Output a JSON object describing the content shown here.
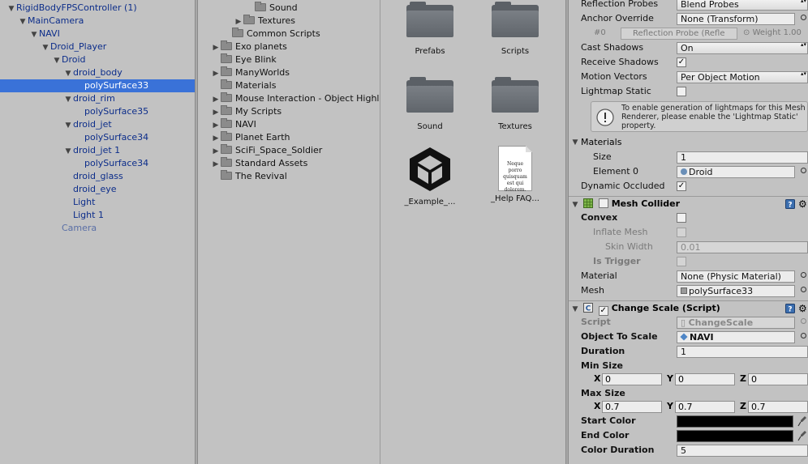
{
  "hierarchy": {
    "items": [
      {
        "label": "RigidBodyFPSController (1)",
        "indent": 0,
        "arrow": "open"
      },
      {
        "label": "MainCamera",
        "indent": 1,
        "arrow": "open"
      },
      {
        "label": "NAVI",
        "indent": 2,
        "arrow": "open"
      },
      {
        "label": "Droid_Player",
        "indent": 3,
        "arrow": "open"
      },
      {
        "label": "Droid",
        "indent": 4,
        "arrow": "open"
      },
      {
        "label": "droid_body",
        "indent": 5,
        "arrow": "open"
      },
      {
        "label": "polySurface33",
        "indent": 6,
        "arrow": "none",
        "selected": true
      },
      {
        "label": "droid_rim",
        "indent": 5,
        "arrow": "open"
      },
      {
        "label": "polySurface35",
        "indent": 6,
        "arrow": "none"
      },
      {
        "label": "droid_jet",
        "indent": 5,
        "arrow": "open"
      },
      {
        "label": "polySurface34",
        "indent": 6,
        "arrow": "none"
      },
      {
        "label": "droid_jet 1",
        "indent": 5,
        "arrow": "open"
      },
      {
        "label": "polySurface34",
        "indent": 6,
        "arrow": "none"
      },
      {
        "label": "droid_glass",
        "indent": 5,
        "arrow": "none"
      },
      {
        "label": "droid_eye",
        "indent": 5,
        "arrow": "none"
      },
      {
        "label": "Light",
        "indent": 5,
        "arrow": "none"
      },
      {
        "label": "Light 1",
        "indent": 5,
        "arrow": "none"
      },
      {
        "label": "Camera",
        "indent": 4,
        "arrow": "none",
        "dim": true
      }
    ]
  },
  "project_tree": {
    "items": [
      {
        "label": "Sound",
        "indent": 3,
        "arrow": "none"
      },
      {
        "label": "Textures",
        "indent": 2,
        "arrow": "closed"
      },
      {
        "label": "Common Scripts",
        "indent": 1,
        "arrow": "none"
      },
      {
        "label": "Exo planets",
        "indent": 0,
        "arrow": "closed"
      },
      {
        "label": "Eye Blink",
        "indent": 0,
        "arrow": "none"
      },
      {
        "label": "ManyWorlds",
        "indent": 0,
        "arrow": "closed"
      },
      {
        "label": "Materials",
        "indent": 0,
        "arrow": "none"
      },
      {
        "label": "Mouse Interaction - Object Highl",
        "indent": 0,
        "arrow": "closed"
      },
      {
        "label": "My Scripts",
        "indent": 0,
        "arrow": "closed"
      },
      {
        "label": "NAVI",
        "indent": 0,
        "arrow": "closed"
      },
      {
        "label": "Planet Earth",
        "indent": 0,
        "arrow": "closed"
      },
      {
        "label": "SciFi_Space_Soldier",
        "indent": 0,
        "arrow": "closed"
      },
      {
        "label": "Standard Assets",
        "indent": 0,
        "arrow": "closed"
      },
      {
        "label": "The Revival",
        "indent": 0,
        "arrow": "none"
      }
    ]
  },
  "asset_grid": {
    "prefabs": "Prefabs",
    "scripts": "Scripts",
    "sound": "Sound",
    "textures": "Textures",
    "example": "_Example_...",
    "help": "_Help FAQ...",
    "help_doc_text": "Neque porro quisquam est qui dolorem."
  },
  "inspector": {
    "reflection_probes_label": "Reflection Probes",
    "reflection_probes_value": "Blend Probes",
    "anchor_override_label": "Anchor Override",
    "anchor_override_value": "None (Transform)",
    "probe_index": "#0",
    "probe_value": "Reflection Probe (Refle",
    "probe_weight": "Weight 1.00",
    "cast_shadows_label": "Cast Shadows",
    "cast_shadows_value": "On",
    "receive_shadows_label": "Receive Shadows",
    "motion_vectors_label": "Motion Vectors",
    "motion_vectors_value": "Per Object Motion",
    "lightmap_static_label": "Lightmap Static",
    "lightmap_help": "To enable generation of lightmaps for this Mesh Renderer, please enable the 'Lightmap Static' property.",
    "materials_label": "Materials",
    "size_label": "Size",
    "size_value": "1",
    "element0_label": "Element 0",
    "element0_value": "Droid",
    "dynamic_occluded_label": "Dynamic Occluded",
    "mesh_collider": {
      "title": "Mesh Collider",
      "convex_label": "Convex",
      "inflate_label": "Inflate Mesh",
      "skin_label": "Skin Width",
      "skin_value": "0.01",
      "trigger_label": "Is Trigger",
      "material_label": "Material",
      "material_value": "None (Physic Material)",
      "mesh_label": "Mesh",
      "mesh_value": "polySurface33"
    },
    "change_scale": {
      "title": "Change Scale (Script)",
      "script_label": "Script",
      "script_value": "ChangeScale",
      "object_label": "Object To Scale",
      "object_value": "NAVI",
      "duration_label": "Duration",
      "duration_value": "1",
      "min_size_label": "Min Size",
      "min_x": "0",
      "min_y": "0",
      "min_z": "0",
      "max_size_label": "Max Size",
      "max_x": "0.7",
      "max_y": "0.7",
      "max_z": "0.7",
      "x": "X",
      "y": "Y",
      "z": "Z",
      "start_color_label": "Start Color",
      "end_color_label": "End Color",
      "color_duration_label": "Color Duration",
      "color_duration_value": "5"
    }
  }
}
